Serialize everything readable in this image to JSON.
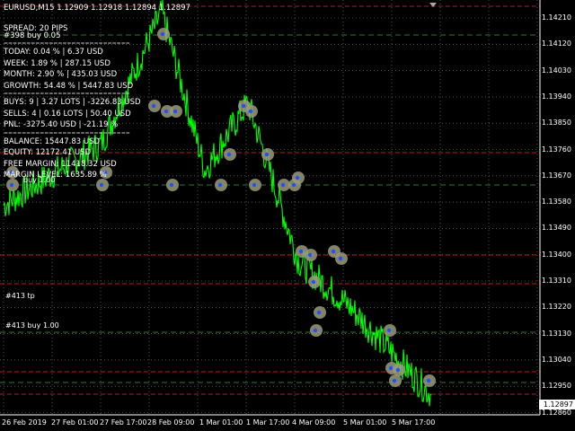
{
  "symbol_header": "EURUSD,M15  1.12909 1.12918 1.12894 1.12897",
  "panel": {
    "spread": "SPREAD: 20 PIPS",
    "order_label": "#398 buy 0.05",
    "sep": "============================",
    "today": "TODAY: 0.04 % | 6.37 USD",
    "week": "WEEK: 1.89 % | 287.15 USD",
    "month": "MONTH: 2.90 % | 435.03 USD",
    "growth": "GROWTH: 54.48 % | 5447.83 USD",
    "buys": "BUYS: 9 | 3.27 LOTS | -3226.83 USD",
    "sells": "SELLS: 4 | 0.16 LOTS | 50.40 USD",
    "pnl": "PNL: -3275.40 USD | -21.19 %",
    "balance": "BALANCE: 15447.83 USD",
    "equity": "EQUITY: 12172.41 USD",
    "free_margin": "FREE MARGIN: 11418.32 USD",
    "margin_level": "MARGIN LEVEL: 1635.89 %",
    "buy_label_1": "buy 1.00"
  },
  "order_lines": {
    "tp_label": "#413 tp",
    "buy_label": "#413 buy 1.00"
  },
  "price_axis": [
    "1.14210",
    "1.14120",
    "1.14030",
    "1.13940",
    "1.13850",
    "1.13760",
    "1.13670",
    "1.13580",
    "1.13490",
    "1.13400",
    "1.13310",
    "1.13220",
    "1.13130",
    "1.13040",
    "1.12950",
    "1.12860"
  ],
  "current_price": "1.12897",
  "time_axis": [
    "26 Feb 2019",
    "27 Feb 01:00",
    "27 Feb 17:00",
    "28 Feb 09:00",
    "1 Mar 01:00",
    "1 Mar 17:00",
    "4 Mar 09:00",
    "5 Mar 01:00",
    "5 Mar 17:00"
  ],
  "colors": {
    "background": "#000000",
    "price_line": "#00ff00",
    "grid": "#ffffff",
    "red_line": "#ff2020",
    "green_dash": "#3fa03f",
    "marker": "#9a9a7a"
  },
  "chart_data": {
    "type": "line",
    "title": "EURUSD,M15",
    "ylim": [
      1.1282,
      1.143
    ],
    "x": [
      "26 Feb 2019",
      "27 Feb 01:00",
      "27 Feb 17:00",
      "28 Feb 09:00",
      "1 Mar 01:00",
      "1 Mar 17:00",
      "4 Mar 09:00",
      "5 Mar 01:00",
      "5 Mar 17:00"
    ],
    "series": [
      {
        "values": [
          1.1357,
          1.1368,
          1.1378,
          1.1423,
          1.1369,
          1.1392,
          1.1338,
          1.1322,
          1.1292
        ]
      }
    ]
  }
}
